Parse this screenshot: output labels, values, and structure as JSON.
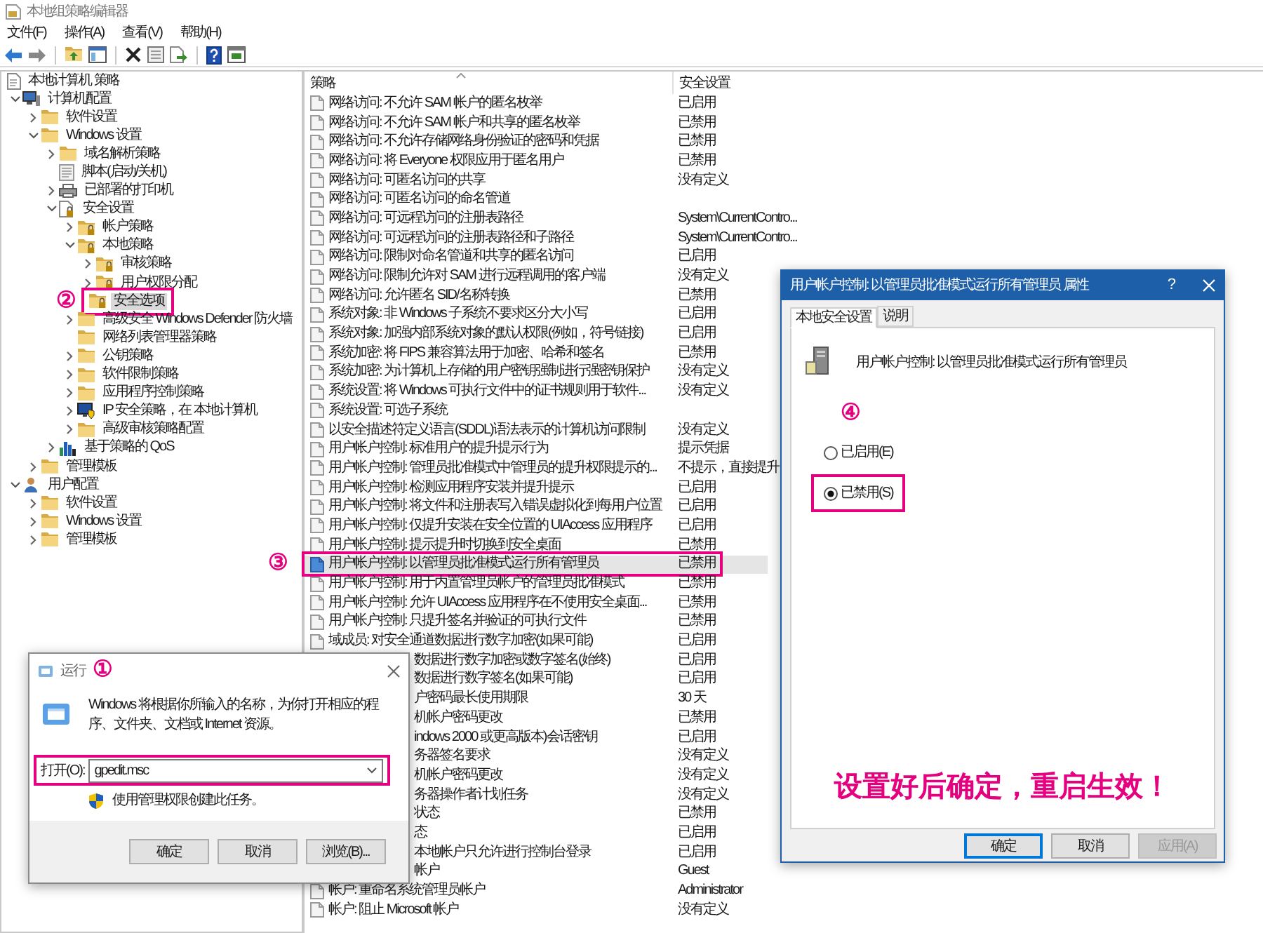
{
  "window": {
    "title": "本地组策略编辑器"
  },
  "menu": [
    "文件(F)",
    "操作(A)",
    "查看(V)",
    "帮助(H)"
  ],
  "tree": [
    {
      "label": "本地计算机 策略",
      "kind": "policy",
      "selected": false,
      "children": [
        {
          "label": "计算机配置",
          "kind": "computer",
          "expanded": true,
          "selected": false,
          "children": [
            {
              "label": "软件设置",
              "kind": "folder",
              "expanded": false,
              "selected": false
            },
            {
              "label": "Windows 设置",
              "kind": "folder",
              "expanded": true,
              "selected": false,
              "children": [
                {
                  "label": "域名解析策略",
                  "kind": "folder",
                  "expanded": false,
                  "selected": false
                },
                {
                  "label": "脚本(启动/关机)",
                  "kind": "script",
                  "selected": false
                },
                {
                  "label": "已部署的打印机",
                  "kind": "printer",
                  "expanded": false,
                  "selected": false
                },
                {
                  "label": "安全设置",
                  "kind": "security",
                  "expanded": true,
                  "selected": false,
                  "children": [
                    {
                      "label": "帐户策略",
                      "kind": "lockfolder",
                      "expanded": false,
                      "selected": false
                    },
                    {
                      "label": "本地策略",
                      "kind": "lockfolder",
                      "expanded": true,
                      "selected": false,
                      "children": [
                        {
                          "label": "审核策略",
                          "kind": "lockfolder",
                          "expanded": false,
                          "selected": false
                        },
                        {
                          "label": "用户权限分配",
                          "kind": "lockfolder",
                          "expanded": false,
                          "selected": false
                        },
                        {
                          "label": "安全选项",
                          "kind": "lockfolder",
                          "selected": true,
                          "step": "②"
                        }
                      ]
                    },
                    {
                      "label": "高级安全 Windows Defender 防火墙",
                      "kind": "folder",
                      "expanded": false,
                      "selected": false
                    },
                    {
                      "label": "网络列表管理器策略",
                      "kind": "folder",
                      "selected": false
                    },
                    {
                      "label": "公钥策略",
                      "kind": "folder",
                      "expanded": false,
                      "selected": false
                    },
                    {
                      "label": "软件限制策略",
                      "kind": "folder",
                      "expanded": false,
                      "selected": false
                    },
                    {
                      "label": "应用程序控制策略",
                      "kind": "folder",
                      "expanded": false,
                      "selected": false
                    },
                    {
                      "label": "IP 安全策略，在 本地计算机",
                      "kind": "ip",
                      "expanded": false,
                      "selected": false
                    },
                    {
                      "label": "高级审核策略配置",
                      "kind": "folder",
                      "expanded": false,
                      "selected": false
                    }
                  ]
                },
                {
                  "label": "基于策略的 QoS",
                  "kind": "chart",
                  "expanded": false,
                  "selected": false
                }
              ]
            },
            {
              "label": "管理模板",
              "kind": "folder",
              "expanded": false,
              "selected": false
            }
          ]
        },
        {
          "label": "用户配置",
          "kind": "user",
          "expanded": true,
          "selected": false,
          "children": [
            {
              "label": "软件设置",
              "kind": "folder",
              "expanded": false,
              "selected": false
            },
            {
              "label": "Windows 设置",
              "kind": "folder",
              "expanded": false,
              "selected": false
            },
            {
              "label": "管理模板",
              "kind": "folder",
              "expanded": false,
              "selected": false
            }
          ]
        }
      ]
    }
  ],
  "policy_table": {
    "columns": [
      "策略",
      "安全设置"
    ],
    "rows": [
      {
        "kind": "policy",
        "name": "网络访问: 不允许 SAM 帐户的匿名枚举",
        "setting": "已启用",
        "selected": false
      },
      {
        "kind": "policy",
        "name": "网络访问: 不允许 SAM 帐户和共享的匿名枚举",
        "setting": "已禁用",
        "selected": false
      },
      {
        "kind": "policy",
        "name": "网络访问: 不允许存储网络身份验证的密码和凭据",
        "setting": "已禁用",
        "selected": false
      },
      {
        "kind": "policy",
        "name": "网络访问: 将 Everyone 权限应用于匿名用户",
        "setting": "已禁用",
        "selected": false
      },
      {
        "kind": "policy",
        "name": "网络访问: 可匿名访问的共享",
        "setting": "没有定义",
        "selected": false
      },
      {
        "kind": "policy",
        "name": "网络访问: 可匿名访问的命名管道",
        "selected": false
      },
      {
        "kind": "policy",
        "name": "网络访问: 可远程访问的注册表路径",
        "setting": "System\\CurrentContro...",
        "selected": false
      },
      {
        "kind": "policy",
        "name": "网络访问: 可远程访问的注册表路径和子路径",
        "setting": "System\\CurrentContro...",
        "selected": false
      },
      {
        "kind": "policy",
        "name": "网络访问: 限制对命名管道和共享的匿名访问",
        "setting": "已启用",
        "selected": false
      },
      {
        "kind": "policy",
        "name": "网络访问: 限制允许对 SAM 进行远程调用的客户端",
        "setting": "没有定义",
        "selected": false
      },
      {
        "kind": "policy",
        "name": "网络访问: 允许匿名 SID/名称转换",
        "setting": "已禁用",
        "selected": false
      },
      {
        "kind": "policy",
        "name": "系统对象: 非 Windows 子系统不要求区分大小写",
        "setting": "已启用",
        "selected": false
      },
      {
        "kind": "policy",
        "name": "系统对象: 加强内部系统对象的默认权限(例如，符号链接)",
        "setting": "已启用",
        "selected": false
      },
      {
        "kind": "policy",
        "name": "系统加密: 将 FIPS 兼容算法用于加密、哈希和签名",
        "setting": "已禁用",
        "selected": false
      },
      {
        "kind": "policy",
        "name": "系统加密: 为计算机上存储的用户密钥强制进行强密钥保护",
        "setting": "没有定义",
        "selected": false
      },
      {
        "kind": "policy",
        "name": "系统设置: 将 Windows 可执行文件中的证书规则用于软件...",
        "setting": "没有定义",
        "selected": false
      },
      {
        "kind": "policy",
        "name": "系统设置: 可选子系统",
        "selected": false
      },
      {
        "kind": "policy",
        "name": "以安全描述符定义语言(SDDL)语法表示的计算机访问限制",
        "setting": "没有定义",
        "selected": false
      },
      {
        "kind": "policy",
        "name": "用户帐户控制: 标准用户的提升提示行为",
        "setting": "提示凭据",
        "selected": false
      },
      {
        "kind": "policy",
        "name": "用户帐户控制: 管理员批准模式中管理员的提升权限提示的...",
        "setting": "不提示，直接提升",
        "selected": false
      },
      {
        "kind": "policy",
        "name": "用户帐户控制: 检测应用程序安装并提升提示",
        "setting": "已启用",
        "selected": false
      },
      {
        "kind": "policy",
        "name": "用户帐户控制: 将文件和注册表写入错误虚拟化到每用户位置",
        "setting": "已启用",
        "selected": false
      },
      {
        "kind": "policy",
        "name": "用户帐户控制: 仅提升安装在安全位置的 UIAccess 应用程序",
        "setting": "已启用",
        "selected": false
      },
      {
        "kind": "policy",
        "name": "用户帐户控制: 提示提升时切换到安全桌面",
        "setting": "已禁用",
        "selected": false
      },
      {
        "kind": "policy",
        "name": "用户帐户控制: 以管理员批准模式运行所有管理员",
        "setting": "已禁用",
        "selected": true,
        "step": "③"
      },
      {
        "kind": "policy",
        "name": "用户帐户控制: 用于内置管理员帐户的管理员批准模式",
        "setting": "已禁用",
        "selected": false
      },
      {
        "kind": "policy",
        "name": "用户帐户控制: 允许 UIAccess 应用程序在不使用安全桌面...",
        "setting": "已禁用",
        "selected": false
      },
      {
        "kind": "policy",
        "name": "用户帐户控制: 只提升签名并验证的可执行文件",
        "setting": "已禁用",
        "selected": false
      },
      {
        "kind": "policy",
        "name": "域成员: 对安全通道数据进行数字加密(如果可能)",
        "setting": "已启用",
        "selected": false
      },
      {
        "kind": "fragment",
        "name": "数据进行数字加密或数字签名(始终)",
        "setting": "已启用",
        "selected": false
      },
      {
        "kind": "fragment",
        "name": "数据进行数字签名(如果可能)",
        "setting": "已启用",
        "selected": false
      },
      {
        "kind": "fragment",
        "name": "户密码最长使用期限",
        "setting": "30 天",
        "selected": false
      },
      {
        "kind": "fragment",
        "name": "机帐户密码更改",
        "setting": "已禁用",
        "selected": false
      },
      {
        "kind": "fragment",
        "name": "indows 2000 或更高版本)会话密钥",
        "setting": "已启用",
        "selected": false
      },
      {
        "kind": "fragment",
        "name": "务器签名要求",
        "setting": "没有定义",
        "selected": false
      },
      {
        "kind": "fragment",
        "name": "机帐户密码更改",
        "setting": "没有定义",
        "selected": false
      },
      {
        "kind": "fragment",
        "name": "务器操作者计划任务",
        "setting": "没有定义",
        "selected": false
      },
      {
        "kind": "fragment",
        "name": "状态",
        "setting": "已禁用",
        "selected": false
      },
      {
        "kind": "fragment",
        "name": "态",
        "setting": "已启用",
        "selected": false
      },
      {
        "kind": "fragment",
        "name": "本地帐户只允许进行控制台登录",
        "setting": "已启用",
        "selected": false
      },
      {
        "kind": "fragment",
        "name": "帐户",
        "setting": "Guest",
        "selected": false
      },
      {
        "kind": "policy",
        "name": "帐户: 重命名系统管理员帐户",
        "setting": "Administrator",
        "selected": false
      },
      {
        "kind": "policy",
        "name": "帐户: 阻止 Microsoft 帐户",
        "setting": "没有定义",
        "selected": false
      }
    ]
  },
  "run_dialog": {
    "title": "运行",
    "step": "①",
    "message": "Windows 将根据你所输入的名称，为你打开相应的程序、文件夹、文档或 Internet 资源。",
    "open_label": "打开(O):",
    "open_value": "gpedit.msc",
    "open_highlighted": true,
    "admin_note": "使用管理权限创建此任务。",
    "buttons": [
      "确定",
      "取消",
      "浏览(B)..."
    ]
  },
  "properties_dialog": {
    "title": "用户帐户控制: 以管理员批准模式运行所有管理员 属性",
    "help": "?",
    "tabs": [
      {
        "label": "本地安全设置",
        "selected": true
      },
      {
        "label": "说明",
        "selected": false
      }
    ],
    "policy_name": "用户帐户控制: 以管理员批准模式运行所有管理员",
    "step": "④",
    "options": [
      {
        "label": "已启用(E)",
        "selected": false,
        "highlighted": false
      },
      {
        "label": "已禁用(S)",
        "selected": true,
        "highlighted": true
      }
    ],
    "note": "设置好后确定，重启生效！",
    "buttons": [
      {
        "label": "确定",
        "default": true,
        "disabled": false
      },
      {
        "label": "取消",
        "default": false,
        "disabled": false
      },
      {
        "label": "应用(A)",
        "default": false,
        "disabled": true
      }
    ]
  }
}
